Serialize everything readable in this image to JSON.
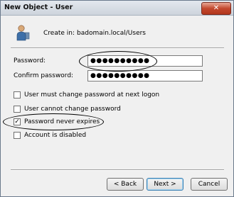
{
  "window": {
    "title": "New Object - User",
    "close_glyph": "✕"
  },
  "header": {
    "create_in_label": "Create in:",
    "create_in_value": "badomain.local/Users",
    "icon": "user-icon"
  },
  "form": {
    "password_label": "Password:",
    "password_value": "●●●●●●●●●●",
    "confirm_label": "Confirm password:",
    "confirm_value": "●●●●●●●●●●"
  },
  "options": [
    {
      "label": "User must change password at next logon",
      "checked": false
    },
    {
      "label": "User cannot change password",
      "checked": false
    },
    {
      "label": "Password never expires",
      "checked": true
    },
    {
      "label": "Account is disabled",
      "checked": false
    }
  ],
  "buttons": {
    "back": "< Back",
    "next": "Next >",
    "cancel": "Cancel"
  }
}
